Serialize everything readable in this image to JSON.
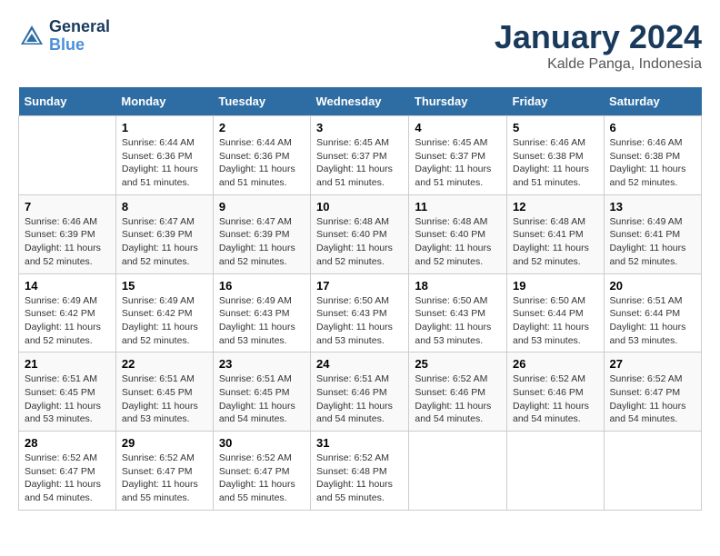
{
  "header": {
    "logo_line1": "General",
    "logo_line2": "Blue",
    "month": "January 2024",
    "location": "Kalde Panga, Indonesia"
  },
  "weekdays": [
    "Sunday",
    "Monday",
    "Tuesday",
    "Wednesday",
    "Thursday",
    "Friday",
    "Saturday"
  ],
  "weeks": [
    [
      {
        "day": "",
        "info": ""
      },
      {
        "day": "1",
        "info": "Sunrise: 6:44 AM\nSunset: 6:36 PM\nDaylight: 11 hours\nand 51 minutes."
      },
      {
        "day": "2",
        "info": "Sunrise: 6:44 AM\nSunset: 6:36 PM\nDaylight: 11 hours\nand 51 minutes."
      },
      {
        "day": "3",
        "info": "Sunrise: 6:45 AM\nSunset: 6:37 PM\nDaylight: 11 hours\nand 51 minutes."
      },
      {
        "day": "4",
        "info": "Sunrise: 6:45 AM\nSunset: 6:37 PM\nDaylight: 11 hours\nand 51 minutes."
      },
      {
        "day": "5",
        "info": "Sunrise: 6:46 AM\nSunset: 6:38 PM\nDaylight: 11 hours\nand 51 minutes."
      },
      {
        "day": "6",
        "info": "Sunrise: 6:46 AM\nSunset: 6:38 PM\nDaylight: 11 hours\nand 52 minutes."
      }
    ],
    [
      {
        "day": "7",
        "info": "Sunrise: 6:46 AM\nSunset: 6:39 PM\nDaylight: 11 hours\nand 52 minutes."
      },
      {
        "day": "8",
        "info": "Sunrise: 6:47 AM\nSunset: 6:39 PM\nDaylight: 11 hours\nand 52 minutes."
      },
      {
        "day": "9",
        "info": "Sunrise: 6:47 AM\nSunset: 6:39 PM\nDaylight: 11 hours\nand 52 minutes."
      },
      {
        "day": "10",
        "info": "Sunrise: 6:48 AM\nSunset: 6:40 PM\nDaylight: 11 hours\nand 52 minutes."
      },
      {
        "day": "11",
        "info": "Sunrise: 6:48 AM\nSunset: 6:40 PM\nDaylight: 11 hours\nand 52 minutes."
      },
      {
        "day": "12",
        "info": "Sunrise: 6:48 AM\nSunset: 6:41 PM\nDaylight: 11 hours\nand 52 minutes."
      },
      {
        "day": "13",
        "info": "Sunrise: 6:49 AM\nSunset: 6:41 PM\nDaylight: 11 hours\nand 52 minutes."
      }
    ],
    [
      {
        "day": "14",
        "info": "Sunrise: 6:49 AM\nSunset: 6:42 PM\nDaylight: 11 hours\nand 52 minutes."
      },
      {
        "day": "15",
        "info": "Sunrise: 6:49 AM\nSunset: 6:42 PM\nDaylight: 11 hours\nand 52 minutes."
      },
      {
        "day": "16",
        "info": "Sunrise: 6:49 AM\nSunset: 6:43 PM\nDaylight: 11 hours\nand 53 minutes."
      },
      {
        "day": "17",
        "info": "Sunrise: 6:50 AM\nSunset: 6:43 PM\nDaylight: 11 hours\nand 53 minutes."
      },
      {
        "day": "18",
        "info": "Sunrise: 6:50 AM\nSunset: 6:43 PM\nDaylight: 11 hours\nand 53 minutes."
      },
      {
        "day": "19",
        "info": "Sunrise: 6:50 AM\nSunset: 6:44 PM\nDaylight: 11 hours\nand 53 minutes."
      },
      {
        "day": "20",
        "info": "Sunrise: 6:51 AM\nSunset: 6:44 PM\nDaylight: 11 hours\nand 53 minutes."
      }
    ],
    [
      {
        "day": "21",
        "info": "Sunrise: 6:51 AM\nSunset: 6:45 PM\nDaylight: 11 hours\nand 53 minutes."
      },
      {
        "day": "22",
        "info": "Sunrise: 6:51 AM\nSunset: 6:45 PM\nDaylight: 11 hours\nand 53 minutes."
      },
      {
        "day": "23",
        "info": "Sunrise: 6:51 AM\nSunset: 6:45 PM\nDaylight: 11 hours\nand 54 minutes."
      },
      {
        "day": "24",
        "info": "Sunrise: 6:51 AM\nSunset: 6:46 PM\nDaylight: 11 hours\nand 54 minutes."
      },
      {
        "day": "25",
        "info": "Sunrise: 6:52 AM\nSunset: 6:46 PM\nDaylight: 11 hours\nand 54 minutes."
      },
      {
        "day": "26",
        "info": "Sunrise: 6:52 AM\nSunset: 6:46 PM\nDaylight: 11 hours\nand 54 minutes."
      },
      {
        "day": "27",
        "info": "Sunrise: 6:52 AM\nSunset: 6:47 PM\nDaylight: 11 hours\nand 54 minutes."
      }
    ],
    [
      {
        "day": "28",
        "info": "Sunrise: 6:52 AM\nSunset: 6:47 PM\nDaylight: 11 hours\nand 54 minutes."
      },
      {
        "day": "29",
        "info": "Sunrise: 6:52 AM\nSunset: 6:47 PM\nDaylight: 11 hours\nand 55 minutes."
      },
      {
        "day": "30",
        "info": "Sunrise: 6:52 AM\nSunset: 6:47 PM\nDaylight: 11 hours\nand 55 minutes."
      },
      {
        "day": "31",
        "info": "Sunrise: 6:52 AM\nSunset: 6:48 PM\nDaylight: 11 hours\nand 55 minutes."
      },
      {
        "day": "",
        "info": ""
      },
      {
        "day": "",
        "info": ""
      },
      {
        "day": "",
        "info": ""
      }
    ]
  ]
}
